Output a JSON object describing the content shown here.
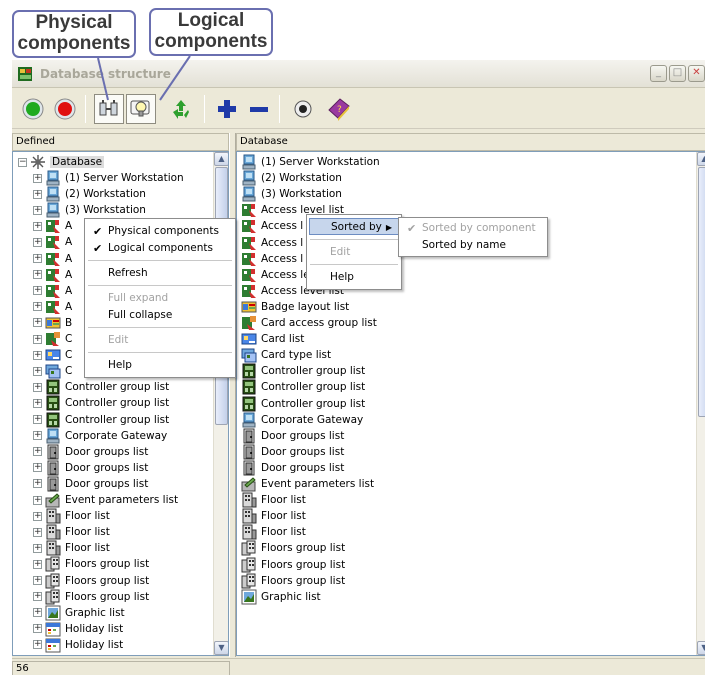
{
  "callouts": {
    "physical": [
      "Physical",
      "components"
    ],
    "logical": [
      "Logical",
      "components"
    ]
  },
  "window": {
    "title": "Database structure",
    "minimize_symbol": "_",
    "maximize_symbol": "□",
    "close_symbol": "✕"
  },
  "toolbar": {
    "buttons": [
      {
        "name": "start-button",
        "icon": "green-circle-icon"
      },
      {
        "name": "stop-button",
        "icon": "red-circle-icon"
      },
      {
        "name": "physical-components-button",
        "icon": "network-devices-icon",
        "pressed": true
      },
      {
        "name": "logical-components-button",
        "icon": "lightbulb-icon",
        "pressed": true
      },
      {
        "name": "refresh-button",
        "icon": "recycle-icon"
      },
      {
        "name": "expand-button",
        "icon": "plus-icon"
      },
      {
        "name": "collapse-button",
        "icon": "minus-icon"
      },
      {
        "name": "record-button",
        "icon": "record-icon"
      },
      {
        "name": "help-button",
        "icon": "help-book-icon"
      }
    ],
    "colors": {
      "green": "#1faa1f",
      "red": "#e01010",
      "plus": "#1f3aa8",
      "recycle": "#2ea02e",
      "book": "#9a3aa0"
    }
  },
  "left_pane": {
    "header": "Defined",
    "root_label": "Database",
    "rows": [
      {
        "label": "(1) Server Workstation",
        "icon": "workstation-icon"
      },
      {
        "label": "(2) Workstation",
        "icon": "workstation-icon"
      },
      {
        "label": "(3) Workstation",
        "icon": "workstation-icon"
      },
      {
        "label": "A",
        "icon": "access-icon"
      },
      {
        "label": "A",
        "icon": "access-icon"
      },
      {
        "label": "A",
        "icon": "access-icon"
      },
      {
        "label": "A",
        "icon": "access-icon"
      },
      {
        "label": "A",
        "icon": "access-icon"
      },
      {
        "label": "A",
        "icon": "access-icon"
      },
      {
        "label": "B",
        "icon": "badge-layout-icon"
      },
      {
        "label": "C",
        "icon": "card-access-icon"
      },
      {
        "label": "C",
        "icon": "card-icon"
      },
      {
        "label": "C",
        "icon": "card-type-icon"
      },
      {
        "label": "Controller group list",
        "icon": "controller-icon"
      },
      {
        "label": "Controller group list",
        "icon": "controller-icon"
      },
      {
        "label": "Controller group list",
        "icon": "controller-icon"
      },
      {
        "label": "Corporate Gateway",
        "icon": "workstation-icon"
      },
      {
        "label": "Door groups list",
        "icon": "door-icon"
      },
      {
        "label": "Door groups list",
        "icon": "door-icon"
      },
      {
        "label": "Door groups list",
        "icon": "door-icon"
      },
      {
        "label": "Event parameters list",
        "icon": "event-icon"
      },
      {
        "label": "Floor list",
        "icon": "floor-icon"
      },
      {
        "label": "Floor list",
        "icon": "floor-icon"
      },
      {
        "label": "Floor list",
        "icon": "floor-icon"
      },
      {
        "label": "Floors group list",
        "icon": "floors-group-icon"
      },
      {
        "label": "Floors group list",
        "icon": "floors-group-icon"
      },
      {
        "label": "Floors group list",
        "icon": "floors-group-icon"
      },
      {
        "label": "Graphic list",
        "icon": "graphic-icon"
      },
      {
        "label": "Holiday list",
        "icon": "holiday-icon"
      },
      {
        "label": "Holiday list",
        "icon": "holiday-icon"
      }
    ]
  },
  "right_pane": {
    "header": "Database",
    "rows": [
      {
        "label": "(1) Server Workstation",
        "icon": "workstation-icon"
      },
      {
        "label": "(2) Workstation",
        "icon": "workstation-icon"
      },
      {
        "label": "(3) Workstation",
        "icon": "workstation-icon"
      },
      {
        "label": "Access level list",
        "icon": "access-icon"
      },
      {
        "label": "Access l",
        "icon": "access-icon"
      },
      {
        "label": "Access l",
        "icon": "access-icon"
      },
      {
        "label": "Access l",
        "icon": "access-icon"
      },
      {
        "label": "Access level list",
        "icon": "access-icon"
      },
      {
        "label": "Access level list",
        "icon": "access-icon"
      },
      {
        "label": "Badge layout list",
        "icon": "badge-layout-icon"
      },
      {
        "label": "Card access group list",
        "icon": "card-access-icon"
      },
      {
        "label": "Card list",
        "icon": "card-icon"
      },
      {
        "label": "Card type list",
        "icon": "card-type-icon"
      },
      {
        "label": "Controller group list",
        "icon": "controller-icon"
      },
      {
        "label": "Controller group list",
        "icon": "controller-icon"
      },
      {
        "label": "Controller group list",
        "icon": "controller-icon"
      },
      {
        "label": "Corporate Gateway",
        "icon": "workstation-icon"
      },
      {
        "label": "Door groups list",
        "icon": "door-icon"
      },
      {
        "label": "Door groups list",
        "icon": "door-icon"
      },
      {
        "label": "Door groups list",
        "icon": "door-icon"
      },
      {
        "label": "Event parameters list",
        "icon": "event-icon"
      },
      {
        "label": "Floor list",
        "icon": "floor-icon"
      },
      {
        "label": "Floor list",
        "icon": "floor-icon"
      },
      {
        "label": "Floor list",
        "icon": "floor-icon"
      },
      {
        "label": "Floors group list",
        "icon": "floors-group-icon"
      },
      {
        "label": "Floors group list",
        "icon": "floors-group-icon"
      },
      {
        "label": "Floors group list",
        "icon": "floors-group-icon"
      },
      {
        "label": "Graphic list",
        "icon": "graphic-icon"
      }
    ]
  },
  "left_context_menu": {
    "items": [
      {
        "label": "Physical components",
        "checked": true,
        "disabled": false
      },
      {
        "label": "Logical components",
        "checked": true,
        "disabled": false
      },
      {
        "label": "Refresh",
        "checked": false,
        "disabled": false
      },
      {
        "label": "Full expand",
        "checked": false,
        "disabled": true
      },
      {
        "label": "Full collapse",
        "checked": false,
        "disabled": false
      },
      {
        "label": "Edit",
        "checked": false,
        "disabled": true
      },
      {
        "label": "Help",
        "checked": false,
        "disabled": false
      }
    ]
  },
  "right_context_menu": {
    "items": [
      {
        "label": "Sorted by",
        "highlighted": true,
        "submenu": true
      },
      {
        "label": "Edit",
        "disabled": true
      },
      {
        "label": "Help",
        "disabled": false
      }
    ]
  },
  "sort_submenu": {
    "items": [
      {
        "label": "Sorted by component",
        "checked": true,
        "disabled": true
      },
      {
        "label": "Sorted by name",
        "checked": false,
        "disabled": false
      }
    ]
  },
  "status": {
    "count": "56"
  }
}
